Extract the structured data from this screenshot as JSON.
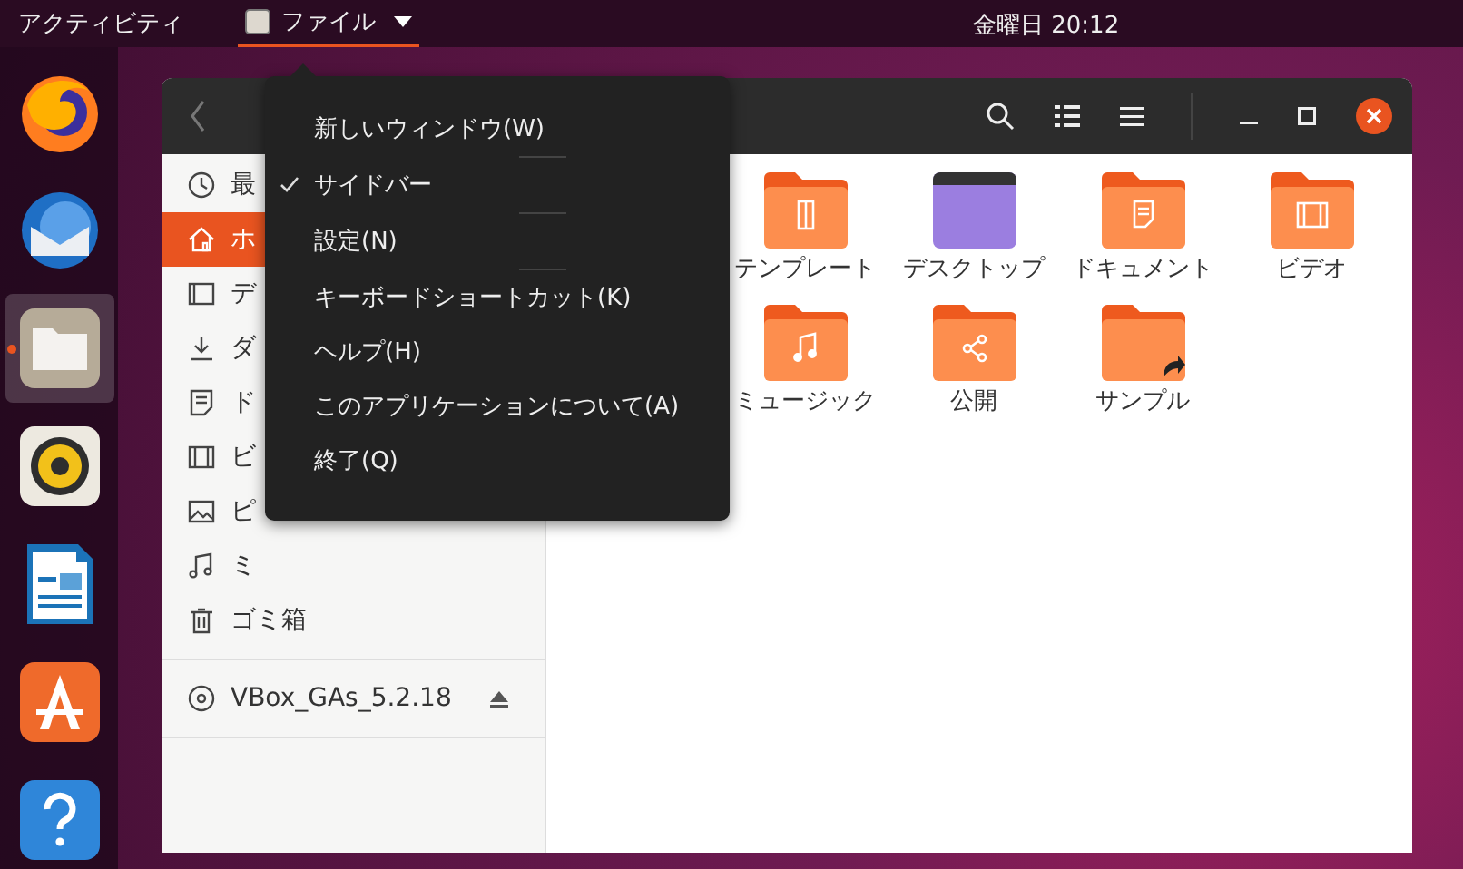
{
  "top_bar": {
    "activities": "アクティビティ",
    "app_menu": "ファイル",
    "clock": "金曜日 20:12"
  },
  "dock": [
    {
      "kind": "firefox",
      "active": false
    },
    {
      "kind": "mail",
      "active": false
    },
    {
      "kind": "files",
      "active": true
    },
    {
      "kind": "speaker",
      "active": false
    },
    {
      "kind": "writer",
      "active": false
    },
    {
      "kind": "store",
      "active": false
    },
    {
      "kind": "help",
      "active": false
    }
  ],
  "sidebar": [
    {
      "kind": "recent",
      "label": "最",
      "selected": false
    },
    {
      "kind": "home",
      "label": "ホ",
      "selected": true
    },
    {
      "kind": "desktop",
      "label": "デ",
      "selected": false
    },
    {
      "kind": "download",
      "label": "ダ",
      "selected": false
    },
    {
      "kind": "document",
      "label": "ド",
      "selected": false
    },
    {
      "kind": "video",
      "label": "ビ",
      "selected": false
    },
    {
      "kind": "picture",
      "label": "ピ",
      "selected": false
    },
    {
      "kind": "music",
      "label": "ミ",
      "selected": false
    },
    {
      "kind": "trash",
      "label": "ゴミ箱",
      "selected": false
    }
  ],
  "devices": [
    {
      "label": "VBox_GAs_5.2.18"
    }
  ],
  "files": [
    {
      "kind": "template",
      "label": "テンプレート"
    },
    {
      "kind": "desktop",
      "label": "デスクトップ"
    },
    {
      "kind": "document",
      "label": "ドキュメント"
    },
    {
      "kind": "video",
      "label": "ビデオ"
    },
    {
      "kind": "music",
      "label": "ミュージック"
    },
    {
      "kind": "public",
      "label": "公開"
    },
    {
      "kind": "link",
      "label": "サンプル"
    }
  ],
  "menu": [
    {
      "kind": "item",
      "label": "新しいウィンドウ(W)"
    },
    {
      "kind": "separator"
    },
    {
      "kind": "check",
      "label": "サイドバー",
      "checked": true
    },
    {
      "kind": "separator"
    },
    {
      "kind": "item",
      "label": "設定(N)"
    },
    {
      "kind": "separator"
    },
    {
      "kind": "item",
      "label": "キーボードショートカット(K)"
    },
    {
      "kind": "item",
      "label": "ヘルプ(H)"
    },
    {
      "kind": "item",
      "label": "このアプリケーションについて(A)"
    },
    {
      "kind": "item",
      "label": "終了(Q)"
    }
  ]
}
